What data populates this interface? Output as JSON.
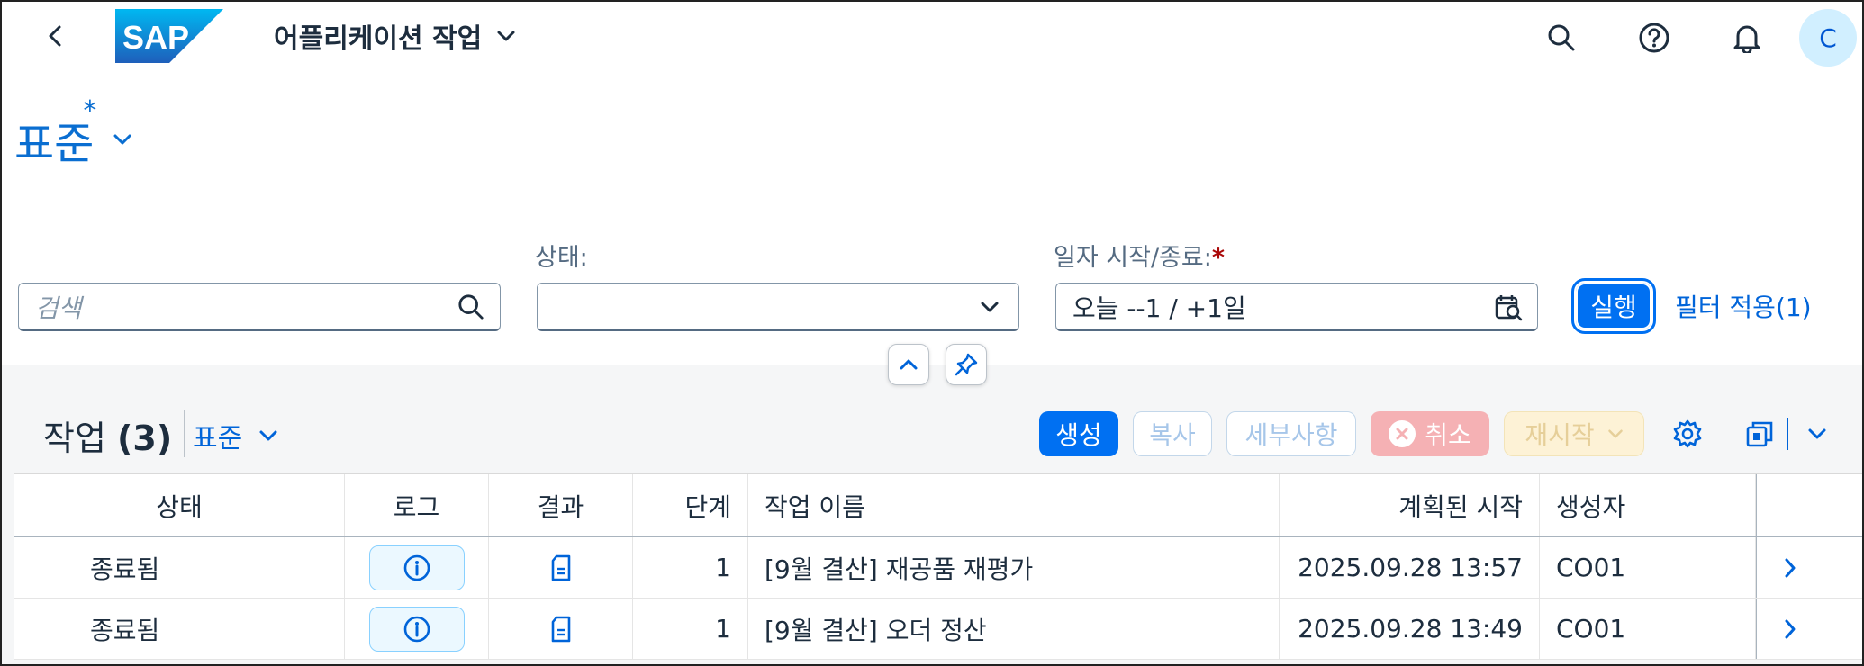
{
  "shell": {
    "app_title": "어플리케이션 작업",
    "avatar_initial": "C",
    "logo_text": "SAP"
  },
  "variant": {
    "title": "표준",
    "modified_mark": "*"
  },
  "filters": {
    "search": {
      "placeholder": "검색",
      "value": ""
    },
    "status": {
      "label": "상태:",
      "value": ""
    },
    "date": {
      "label": "일자 시작/종료:",
      "required_mark": "*",
      "value": "오늘 --1 / +1일"
    },
    "go_label": "실행",
    "adapt_label": "필터 적용(1)"
  },
  "table": {
    "title": "작업",
    "count": "(3)",
    "variant": "표준",
    "toolbar": {
      "create": "생성",
      "copy": "복사",
      "details": "세부사항",
      "cancel": "취소",
      "restart": "재시작"
    },
    "columns": [
      "상태",
      "로그",
      "결과",
      "단계",
      "작업 이름",
      "계획된 시작",
      "생성자"
    ],
    "rows": [
      {
        "status": "종료됨",
        "step": "1",
        "name": "[9월 결산] 재공품 재평가",
        "start": "2025.09.28 13:57",
        "creator": "CO01"
      },
      {
        "status": "종료됨",
        "step": "1",
        "name": "[9월 결산] 오더 정산",
        "start": "2025.09.28 13:49",
        "creator": "CO01"
      }
    ]
  },
  "colors": {
    "accent": "#0070f2",
    "link": "#0064d9",
    "emphasized_button": "#0070f2",
    "reject_button_disabled": "#f5b1b4",
    "attention_button_disabled": "#fdf2d6",
    "avatar_bg": "#d1efff",
    "section_bg": "#f5f6f7"
  },
  "icons": [
    "back-icon",
    "search-icon",
    "help-icon",
    "notification-bell-icon",
    "chevron-down-icon",
    "calendar-icon",
    "collapse-icon",
    "pin-icon",
    "settings-gear-icon",
    "export-icon",
    "info-icon",
    "document-icon",
    "navigation-arrow-icon"
  ]
}
